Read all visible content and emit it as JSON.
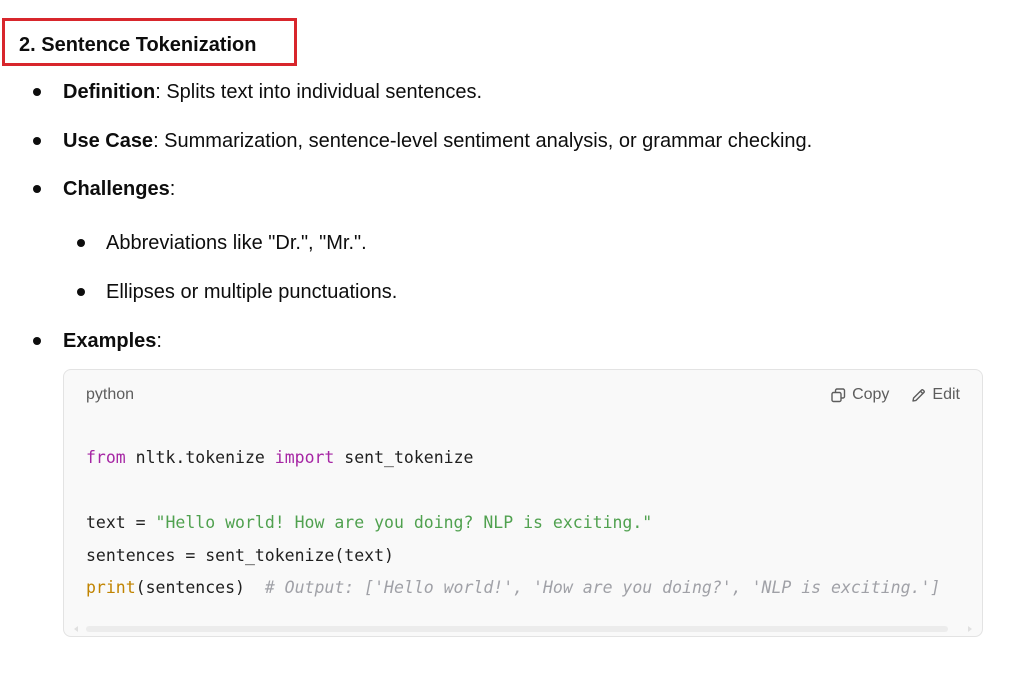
{
  "section": {
    "title": "2. Sentence Tokenization",
    "highlight_color": "#d8262c"
  },
  "bullets": [
    {
      "label": "Definition",
      "text": ": Splits text into individual sentences."
    },
    {
      "label": "Use Case",
      "text": ": Summarization, sentence-level sentiment analysis, or grammar checking."
    },
    {
      "label": "Challenges",
      "text": ":"
    },
    {
      "label": "Examples",
      "text": ":"
    }
  ],
  "sub_bullets": [
    "Abbreviations like \"Dr.\", \"Mr.\".",
    "Ellipses or multiple punctuations."
  ],
  "code_block": {
    "language": "python",
    "copy_label": "Copy",
    "edit_label": "Edit",
    "copy_icon": "copy-icon",
    "edit_icon": "pencil-icon",
    "lines": {
      "l1": {
        "kw1": "from",
        "mod": " nltk.tokenize ",
        "kw2": "import",
        "name": " sent_tokenize"
      },
      "l3": {
        "lhs": "text = ",
        "str": "\"Hello world! How are you doing? NLP is exciting.\""
      },
      "l4": {
        "code": "sentences = sent_tokenize(text)"
      },
      "l5": {
        "fn": "print",
        "args": "(sentences)  ",
        "comment": "# Output: ['Hello world!', 'How are you doing?', 'NLP is exciting.']"
      }
    }
  }
}
